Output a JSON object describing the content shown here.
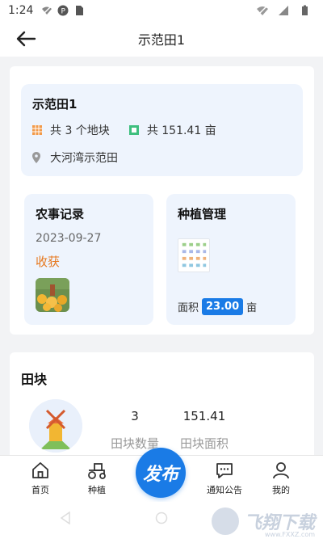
{
  "status_bar": {
    "time": "1:24"
  },
  "header": {
    "title": "示范田1"
  },
  "field_summary": {
    "name": "示范田1",
    "plot_count_text": "共 3 个地块",
    "area_text": "共 151.41 亩",
    "location": "大河湾示范田"
  },
  "farm_record": {
    "title": "农事记录",
    "date": "2023-09-27",
    "type": "收获"
  },
  "planting": {
    "title": "种植管理",
    "area_label": "面积",
    "area_value": "23.00",
    "area_unit": "亩"
  },
  "plots": {
    "title": "田块",
    "count_value": "3",
    "count_label": "田块数量",
    "area_value": "151.41",
    "area_label": "田块面积"
  },
  "bottom_nav": {
    "home": "首页",
    "planting": "种植",
    "publish": "发布",
    "notice": "通知公告",
    "mine": "我的"
  },
  "colors": {
    "accent": "#1a7be6",
    "harvest": "#e6781e",
    "card_bg": "#eef4fd"
  }
}
